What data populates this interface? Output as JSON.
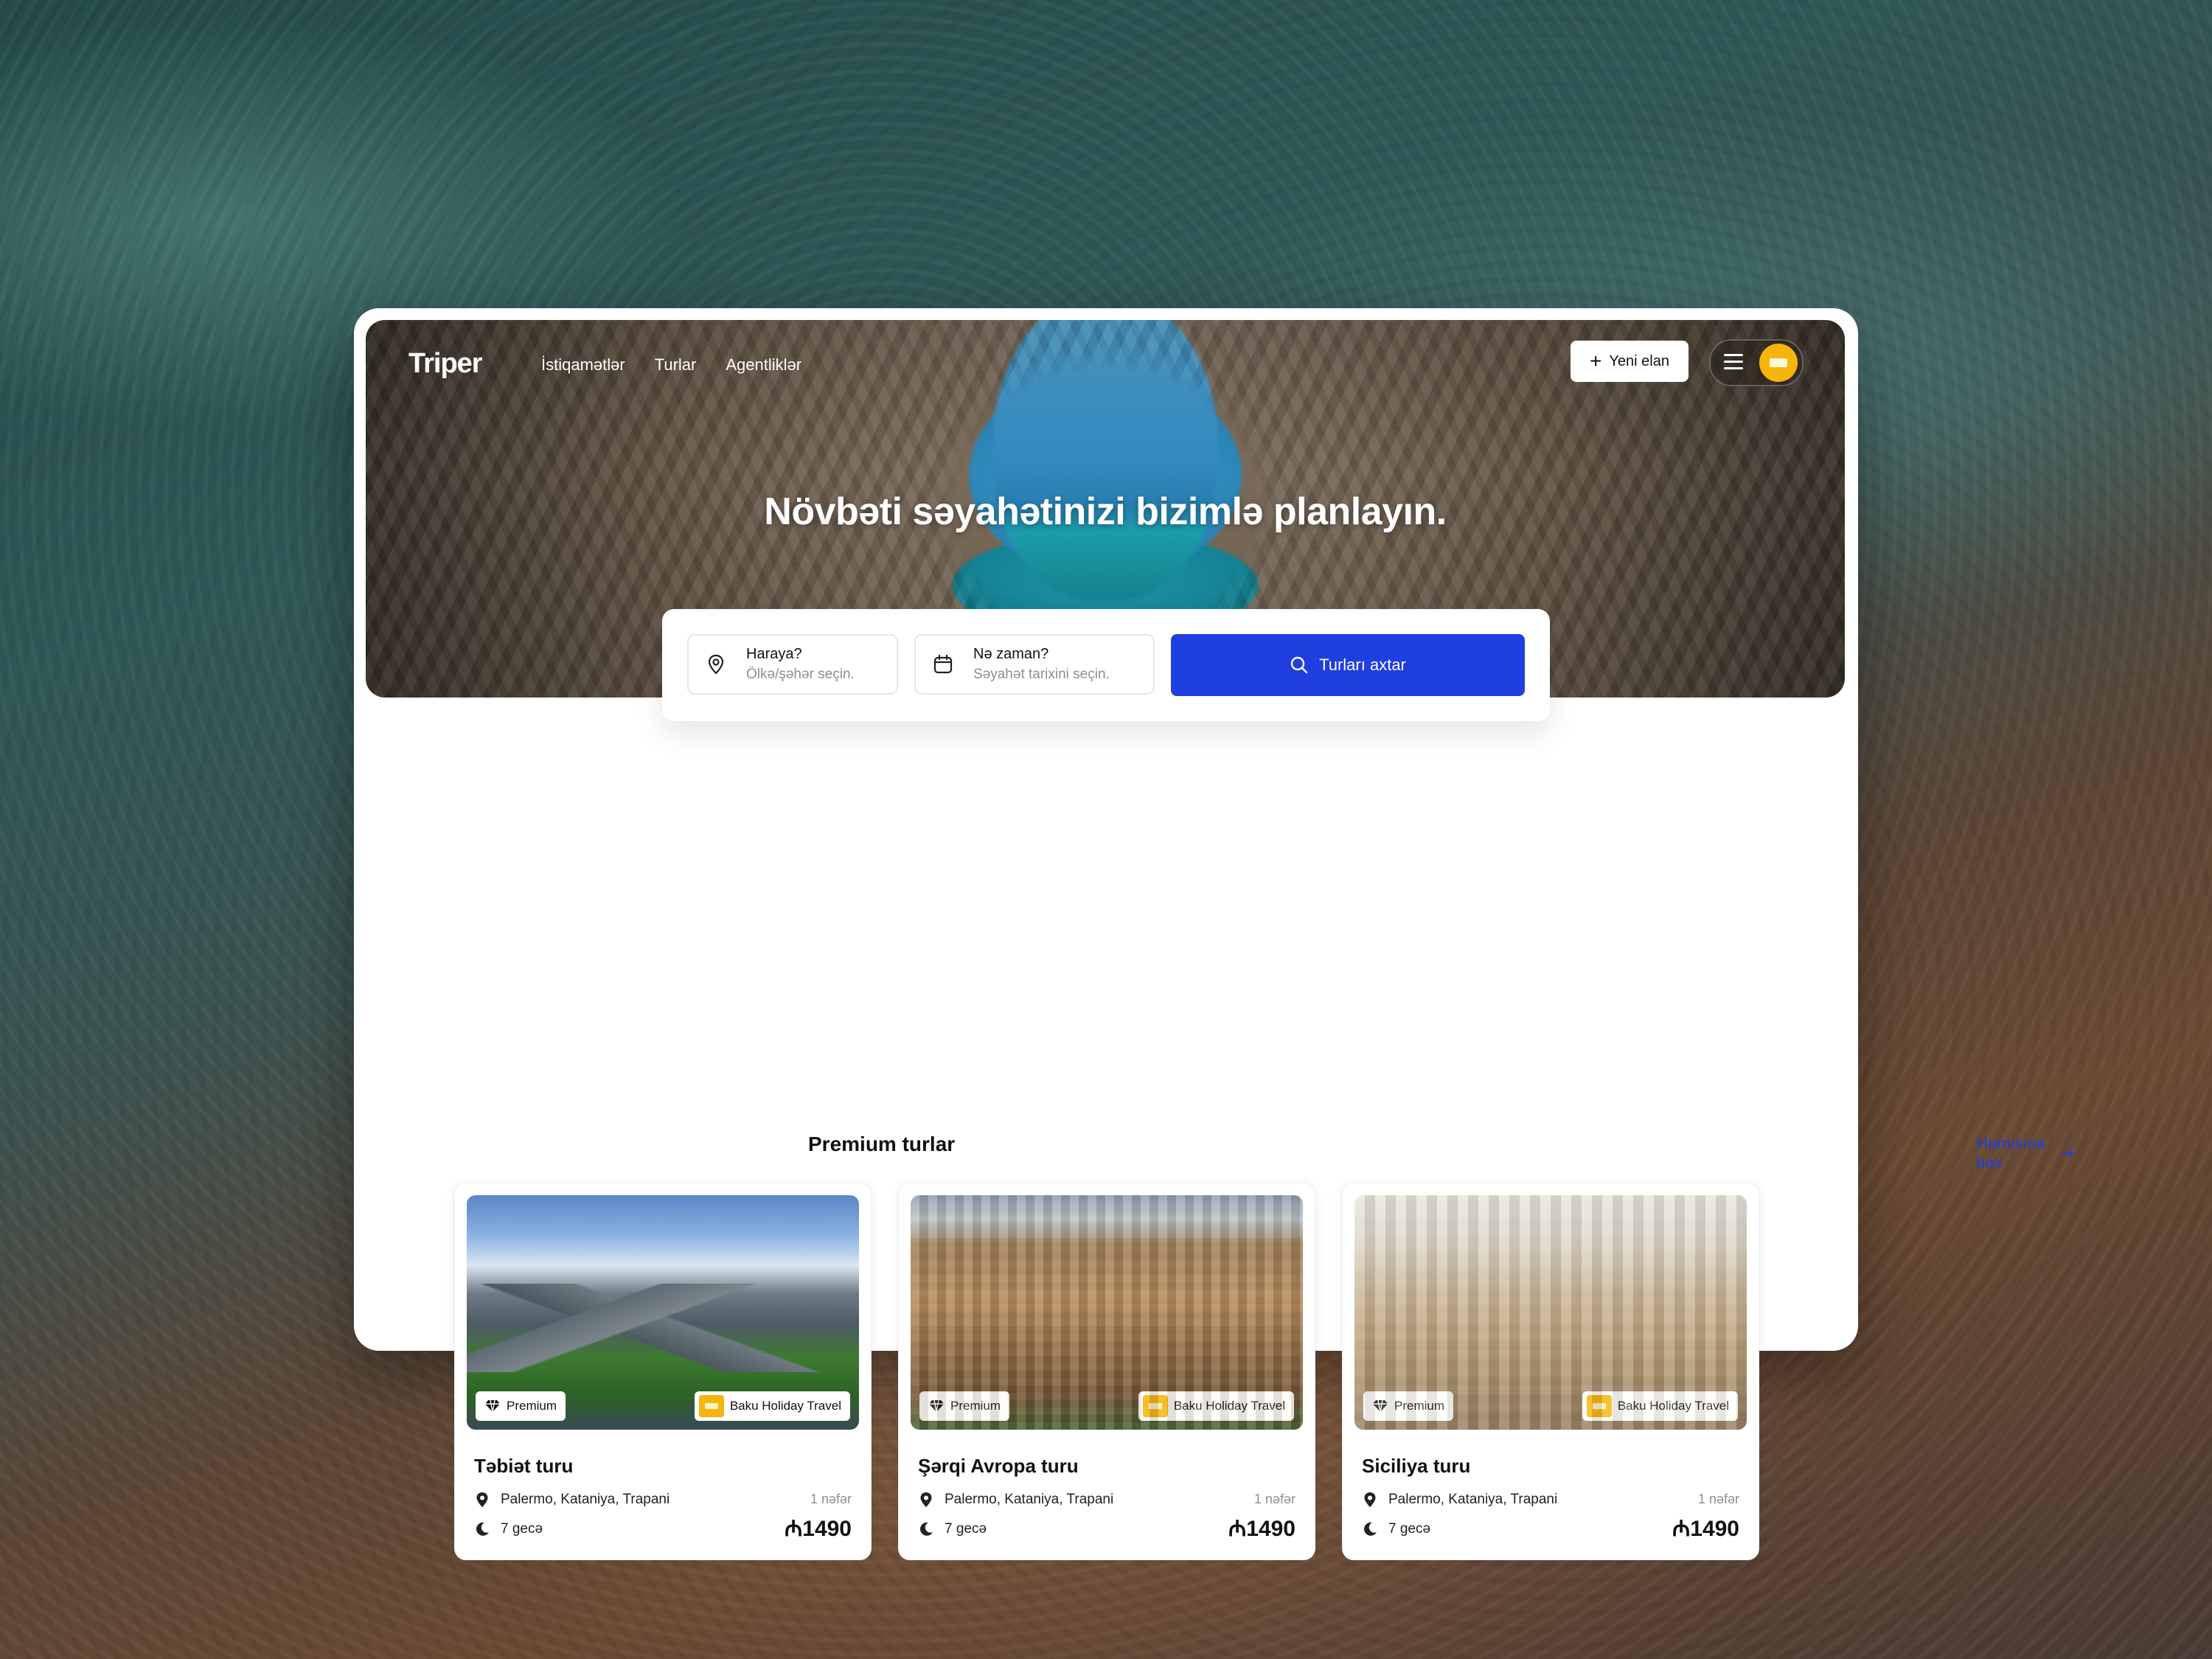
{
  "header": {
    "logo": "Triper",
    "nav": [
      "İstiqamətlər",
      "Turlar",
      "Agentliklər"
    ],
    "new_listing": "Yeni elan"
  },
  "hero": {
    "headline": "Növbəti səyahətinizi bizimlə planlayın."
  },
  "search": {
    "where_label": "Haraya?",
    "where_placeholder": "Ölkə/şəhər seçin.",
    "when_label": "Nə zaman?",
    "when_placeholder": "Səyahət tarixini seçin.",
    "button": "Turları axtar"
  },
  "section": {
    "title": "Premium turlar",
    "see_all": "Hamısına bax"
  },
  "cards": [
    {
      "title": "Təbiət turu",
      "badge": "Premium",
      "agency": "Baku Holiday Travel",
      "location": "Palermo, Kataniya, Trapani",
      "nights": "7 gecə",
      "persons": "1 nəfər",
      "price": "₼1490"
    },
    {
      "title": "Şərqi Avropa turu",
      "badge": "Premium",
      "agency": "Baku Holiday Travel",
      "location": "Palermo, Kataniya, Trapani",
      "nights": "7 gecə",
      "persons": "1 nəfər",
      "price": "₼1490"
    },
    {
      "title": "Siciliya turu",
      "badge": "Premium",
      "agency": "Baku Holiday Travel",
      "location": "Palermo, Kataniya, Trapani",
      "nights": "7 gecə",
      "persons": "1 nəfər",
      "price": "₼1490"
    }
  ],
  "colors": {
    "accent": "#1f3fe0",
    "brand_yellow": "#f5b50a"
  },
  "icons": [
    "menu-icon",
    "plus-icon",
    "map-pin-icon",
    "calendar-icon",
    "search-icon",
    "arrow-right-icon",
    "diamond-icon",
    "location-icon",
    "moon-icon"
  ]
}
